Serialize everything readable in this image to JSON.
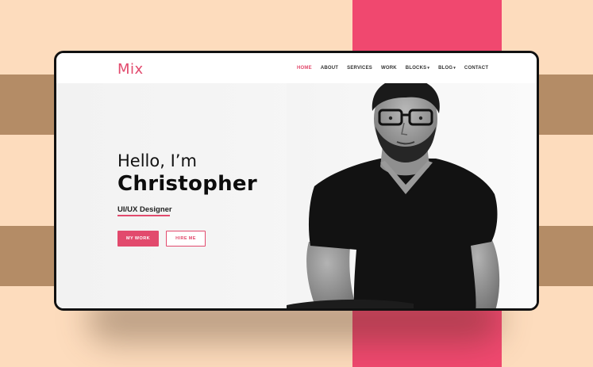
{
  "colors": {
    "accent": "#e24a6d",
    "background_peach": "#fddcbd",
    "stripe_brown": "#b48c66",
    "stripe_pink": "#f0486f"
  },
  "nav": {
    "logo": "Mix",
    "items": [
      {
        "label": "HOME",
        "active": true
      },
      {
        "label": "ABOUT"
      },
      {
        "label": "SERVICES"
      },
      {
        "label": "WORK"
      },
      {
        "label": "BLOCKS",
        "dropdown": true
      },
      {
        "label": "BLOG",
        "dropdown": true
      },
      {
        "label": "CONTACT"
      }
    ],
    "dropdown_icon": "chevron-down-icon"
  },
  "hero": {
    "greeting": "Hello, I’m",
    "name": "Christopher",
    "role": "UI/UX Designer",
    "primary_button": "MY WORK",
    "secondary_button": "HIRE ME",
    "image": "portrait-photo"
  }
}
